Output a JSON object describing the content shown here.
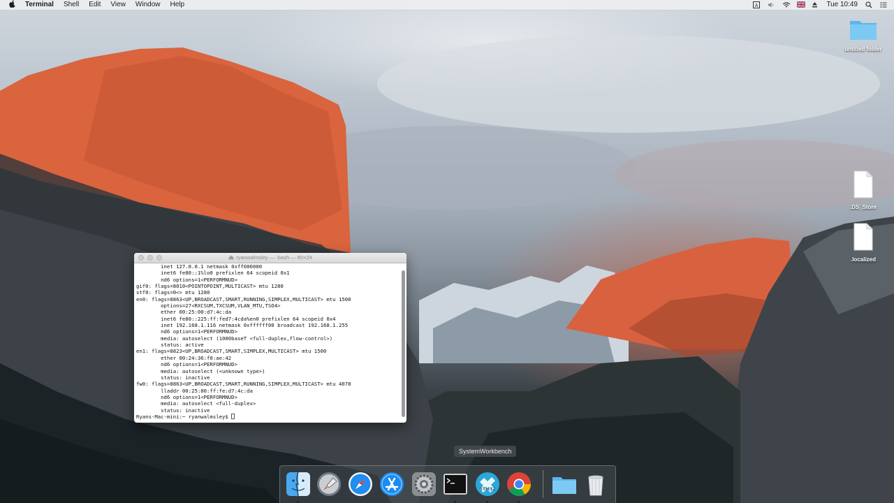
{
  "menubar": {
    "apple_icon": "apple-icon",
    "app_name": "Terminal",
    "menus": [
      "Shell",
      "Edit",
      "View",
      "Window",
      "Help"
    ],
    "clock": "Tue 10:49"
  },
  "desktop_icons": [
    {
      "label": "untitled folder",
      "icon": "folder-icon"
    },
    {
      "label": ".DS_Store",
      "icon": "document-icon"
    },
    {
      "label": ".localized",
      "icon": "document-icon"
    }
  ],
  "terminal": {
    "title": "ryanwalmsley — -bash — 80×24",
    "lines": [
      "        inet 127.0.0.1 netmask 0xff000000",
      "        inet6 fe80::1%lo0 prefixlen 64 scopeid 0x1",
      "        nd6 options=1<PERFORMNUD>",
      "gif0: flags=8010<POINTOPOINT,MULTICAST> mtu 1280",
      "stf0: flags=0<> mtu 1280",
      "en0: flags=8863<UP,BROADCAST,SMART,RUNNING,SIMPLEX,MULTICAST> mtu 1500",
      "        options=27<RXCSUM,TXCSUM,VLAN_MTU,TSO4>",
      "        ether 00:25:00:d7:4c:da",
      "        inet6 fe80::225:ff:fed7:4cda%en0 prefixlen 64 scopeid 0x4",
      "        inet 192.168.1.116 netmask 0xffffff00 broadcast 192.168.1.255",
      "        nd6 options=1<PERFORMNUD>",
      "        media: autoselect (1000baseT <full-duplex,flow-control>)",
      "        status: active",
      "en1: flags=8823<UP,BROADCAST,SMART,SIMPLEX,MULTICAST> mtu 1500",
      "        ether 00:24:36:f0:ae:42",
      "        nd6 options=1<PERFORMNUD>",
      "        media: autoselect (<unknown type>)",
      "        status: inactive",
      "fw0: flags=8863<UP,BROADCAST,SMART,RUNNING,SIMPLEX,MULTICAST> mtu 4078",
      "        lladdr 00:25:00:ff:fe:d7:4c:da",
      "        nd6 options=1<PERFORMNUD>",
      "        media: autoselect <full-duplex>",
      "        status: inactive"
    ],
    "prompt": "Ryans-Mac-mini:~ ryanwalmsley$ "
  },
  "dock": {
    "tooltip": "SystemWorkbench",
    "items": [
      {
        "name": "finder-icon",
        "running": true
      },
      {
        "name": "launchpad-icon",
        "running": false
      },
      {
        "name": "safari-icon",
        "running": false
      },
      {
        "name": "app-store-icon",
        "running": false
      },
      {
        "name": "system-preferences-icon",
        "running": false
      },
      {
        "name": "terminal-icon",
        "running": true
      },
      {
        "name": "systemworkbench-icon",
        "running": true
      },
      {
        "name": "chrome-icon",
        "running": true
      },
      {
        "name": "downloads-folder-icon",
        "running": false
      },
      {
        "name": "trash-icon",
        "running": false
      }
    ],
    "stm_label": "STM32"
  }
}
